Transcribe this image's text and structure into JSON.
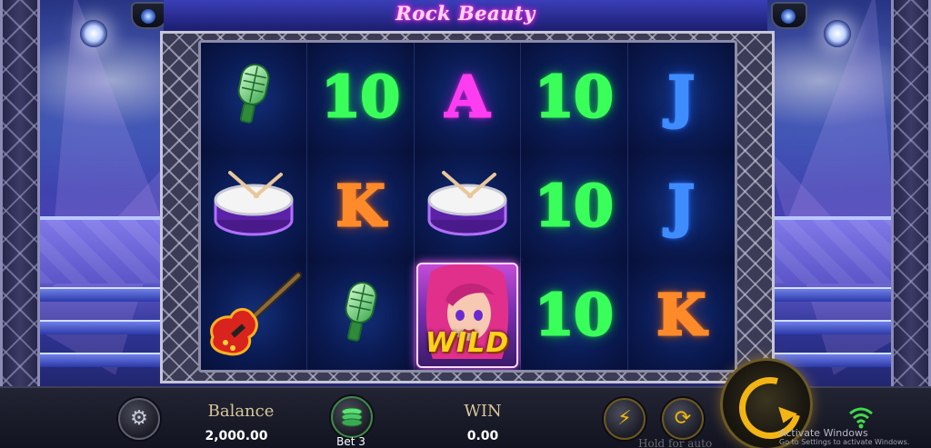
{
  "game": {
    "title": "Rock Beauty"
  },
  "reels": [
    [
      {
        "symbol": "microphone",
        "icon": "microphone-icon"
      },
      {
        "symbol": "10",
        "label": "10"
      },
      {
        "symbol": "A",
        "label": "A"
      },
      {
        "symbol": "10",
        "label": "10"
      },
      {
        "symbol": "J",
        "label": "J"
      }
    ],
    [
      {
        "symbol": "drum",
        "icon": "drum-icon"
      },
      {
        "symbol": "K",
        "label": "K"
      },
      {
        "symbol": "drum",
        "icon": "drum-icon"
      },
      {
        "symbol": "10",
        "label": "10"
      },
      {
        "symbol": "J",
        "label": "J"
      }
    ],
    [
      {
        "symbol": "guitar",
        "icon": "guitar-icon"
      },
      {
        "symbol": "microphone",
        "icon": "microphone-icon"
      },
      {
        "symbol": "wild",
        "label": "WILD"
      },
      {
        "symbol": "10",
        "label": "10"
      },
      {
        "symbol": "K",
        "label": "K"
      }
    ]
  ],
  "bottom": {
    "balance_label": "Balance",
    "balance_value": "2,000.00",
    "bet_label": "Bet 3",
    "win_label": "WIN",
    "win_value": "0.00",
    "hold_hint": "Hold for auto",
    "settings_icon": "gear-icon",
    "bet_icon": "chip-stack-icon",
    "turbo_icon": "lightning-icon",
    "auto_icon": "autoplay-icon",
    "spin_icon": "spin-arrow-icon",
    "signal_icon": "wifi-icon"
  },
  "overlay": {
    "activate_title": "Activate Windows",
    "activate_sub": "Go to Settings to activate Windows."
  },
  "colors": {
    "title_glow": "#ff40d0",
    "ten": "#3aff5a",
    "ace": "#ff3df0",
    "jack": "#3f8cff",
    "king": "#ff8a2a",
    "balance_label": "#d8c69a",
    "spin_gold": "#f2b514"
  }
}
